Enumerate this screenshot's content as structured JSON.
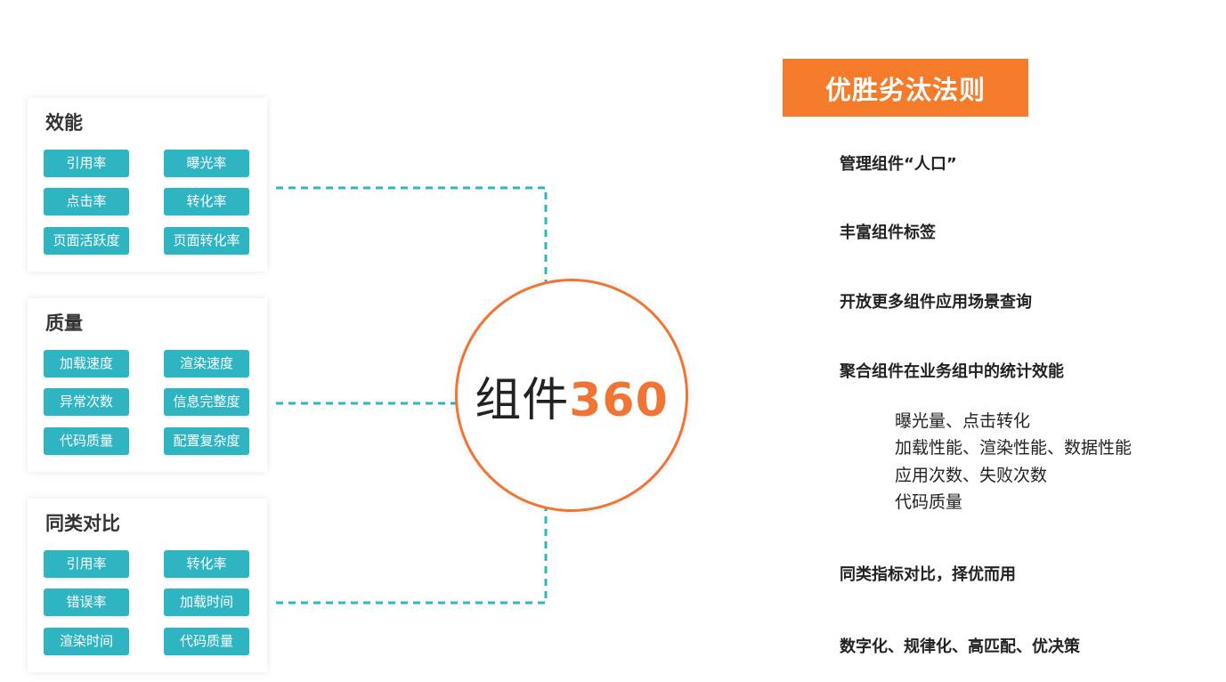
{
  "center": {
    "label": "组件",
    "number": "360"
  },
  "cards": [
    {
      "title": "效能",
      "tags": [
        "引用率",
        "曝光率",
        "点击率",
        "转化率",
        "页面活跃度",
        "页面转化率"
      ]
    },
    {
      "title": "质量",
      "tags": [
        "加载速度",
        "渲染速度",
        "异常次数",
        "信息完整度",
        "代码质量",
        "配置复杂度"
      ]
    },
    {
      "title": "同类对比",
      "tags": [
        "引用率",
        "转化率",
        "错误率",
        "加载时间",
        "渲染时间",
        "代码质量"
      ]
    }
  ],
  "rules": {
    "title": "优胜劣汰法则",
    "items": [
      "管理组件“人口”",
      "丰富组件标签",
      "开放更多组件应用场景查询",
      "聚合组件在业务组中的统计效能",
      "同类指标对比，择优而用",
      "数字化、规律化、高匹配、优决策"
    ],
    "sub_items": [
      "曝光量、点击转化",
      "加载性能、渲染性能、数据性能",
      "应用次数、失败次数",
      "代码质量"
    ]
  },
  "colors": {
    "accent": "#f07434",
    "banner": "#f47b2a",
    "tag": "#2fb4c2",
    "connector": "#2fb4c2"
  }
}
